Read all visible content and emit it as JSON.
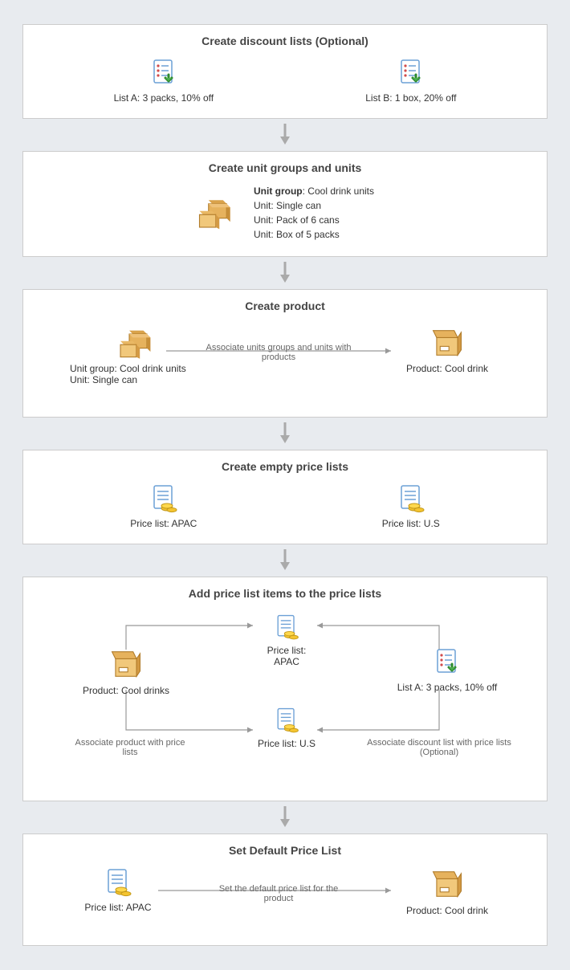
{
  "steps": {
    "s1": {
      "title": "Create discount lists (Optional)",
      "listA": "List A: 3 packs, 10% off",
      "listB": "List B: 1 box, 20% off"
    },
    "s2": {
      "title": "Create unit groups and units",
      "groupLabel": "Unit group",
      "groupValue": ": Cool drink units",
      "u1": "Unit: Single can",
      "u2": "Unit: Pack of 6 cans",
      "u3": "Unit: Box of 5 packs"
    },
    "s3": {
      "title": "Create product",
      "leftLine1": "Unit group: Cool drink units",
      "leftLine2": "Unit: Single can",
      "caption": "Associate units groups and units with products",
      "right": "Product: Cool drink"
    },
    "s4": {
      "title": "Create empty price lists",
      "apac": "Price list: APAC",
      "us": "Price list: U.S"
    },
    "s5": {
      "title": "Add price list items to the price lists",
      "product": "Product: Cool drinks",
      "listA": "List A: 3 packs, 10% off",
      "apac": "Price list: APAC",
      "us": "Price list: U.S",
      "capLeft": "Associate product with price lists",
      "capRight": "Associate discount list with price lists (Optional)"
    },
    "s6": {
      "title": "Set Default Price List",
      "apac": "Price list: APAC",
      "caption": "Set the default price list for the product",
      "product": "Product: Cool drink"
    }
  }
}
